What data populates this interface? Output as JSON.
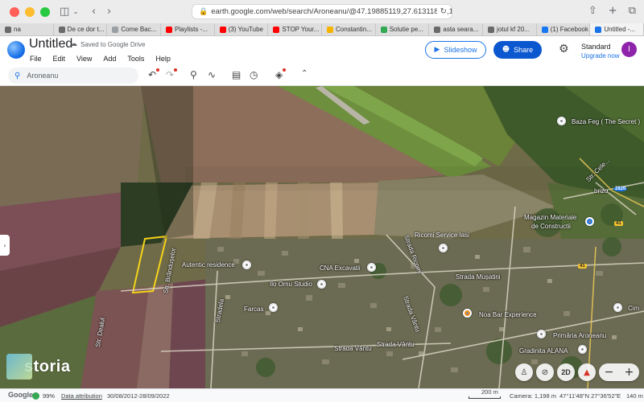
{
  "browser": {
    "url": "earth.google.com/web/search/Aroneanu/@47.19885119,27.61311877,144.8876348",
    "tabs": [
      {
        "label": "na",
        "color": "#6a6a6a"
      },
      {
        "label": "De ce dor t...",
        "color": "#6a6a6a"
      },
      {
        "label": "Come Bac...",
        "color": "#9aa0a6"
      },
      {
        "label": "Playlists -...",
        "color": "#ff0000"
      },
      {
        "label": "(3) YouTube",
        "color": "#ff0000"
      },
      {
        "label": "STOP Your...",
        "color": "#ff0000"
      },
      {
        "label": "Constantin...",
        "color": "#f4b400"
      },
      {
        "label": "Solutie pe...",
        "color": "#34a853"
      },
      {
        "label": "asta seara...",
        "color": "#6a6a6a"
      },
      {
        "label": "jotul kf 20...",
        "color": "#6a6a6a"
      },
      {
        "label": "(1) Facebook",
        "color": "#1877f2"
      },
      {
        "label": "Untitled -...",
        "color": "#1a73e8"
      }
    ]
  },
  "header": {
    "title": "Untitled",
    "saved": "Saved to Google Drive",
    "menu": [
      "File",
      "Edit",
      "View",
      "Add",
      "Tools",
      "Help"
    ],
    "slideshow": "Slideshow",
    "share": "Share",
    "plan": "Standard",
    "upgrade": "Upgrade now",
    "avatar": "I"
  },
  "toolbar": {
    "search_value": "Aroneanu"
  },
  "map": {
    "places": {
      "baza": "Baza Feg ( The Secret )",
      "brizo": "brizo",
      "strc": "Str. Cele...",
      "magazin1": "Magazin Materiale",
      "magazin2": "de Constructii",
      "ricomi": "Ricomi Service Iasi",
      "autentic": "Autentic residence",
      "cna": "CNA Excavatii",
      "iloomu": "Ilo Omu Studio",
      "farcas": "Farcas",
      "musatini": "Strada Mușatini",
      "noa": "Noa Bar Experience",
      "primaria": "Primăria Aroneanu",
      "gradinita": "Gradinita ALANA",
      "ventu1": "Strada Vântu",
      "ventu2": "Strada Vântu",
      "vantu3": "Strada Vântu",
      "dealul": "Str. Dealul",
      "stradela": "Stradela",
      "cim": "Cim",
      "brandusa": "Str. Brândușelor",
      "ricomi_road": "Strada Ricomi"
    },
    "routes": {
      "r2820": "2820",
      "r41": "41",
      "r41b": "41"
    },
    "storia": "storia",
    "view_mode": "2D"
  },
  "status": {
    "google": "Google",
    "percent": "99%",
    "attribution": "Data attribution",
    "dates": "30/08/2012-28/09/2022",
    "scale": "200 m",
    "camera": "Camera: 1,198 m",
    "coords": "47°11'48\"N 27°36'52\"E",
    "elevation": "140 m"
  }
}
